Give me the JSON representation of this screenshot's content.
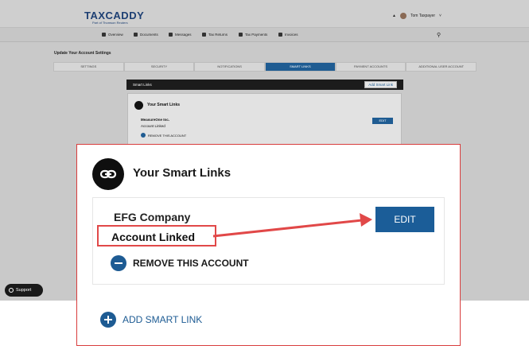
{
  "app": {
    "logo_text": "TAXCADDY",
    "logo_subtitle": "Part of Thomson Reuters",
    "user_name": "Tom Taxpayer",
    "nav": [
      {
        "label": "Overview",
        "icon": "home-icon"
      },
      {
        "label": "Documents",
        "icon": "documents-icon"
      },
      {
        "label": "Messages",
        "icon": "messages-icon"
      },
      {
        "label": "Tax Returns",
        "icon": "tax-returns-icon"
      },
      {
        "label": "Tax Payments",
        "icon": "tax-payments-icon"
      },
      {
        "label": "Invoices",
        "icon": "invoices-icon"
      }
    ],
    "page_title": "Update Your Account Settings",
    "tabs": [
      "SETTINGS",
      "SECURITY",
      "NOTIFICATIONS",
      "SMART LINKS",
      "PAYMENT ACCOUNTS",
      "ADDITIONAL USER ACCOUNT"
    ],
    "active_tab": "SMART LINKS",
    "panel_title": "Smart Links",
    "add_smart_link_label": "Add Smart Link",
    "mini_card": {
      "title": "Your Smart Links",
      "company": "MeasureOne Inc.",
      "status": "Account Linked",
      "remove_label": "REMOVE THIS ACCOUNT",
      "edit_label": "EDIT"
    },
    "support_label": "Support"
  },
  "zoom": {
    "title": "Your Smart Links",
    "company": "EFG Company",
    "status": "Account Linked",
    "edit_label": "EDIT",
    "remove_label": "REMOVE THIS ACCOUNT",
    "add_label": "ADD SMART LINK"
  },
  "colors": {
    "primary_blue": "#1b5d98",
    "highlight_red": "#e14848",
    "dark": "#111111"
  }
}
